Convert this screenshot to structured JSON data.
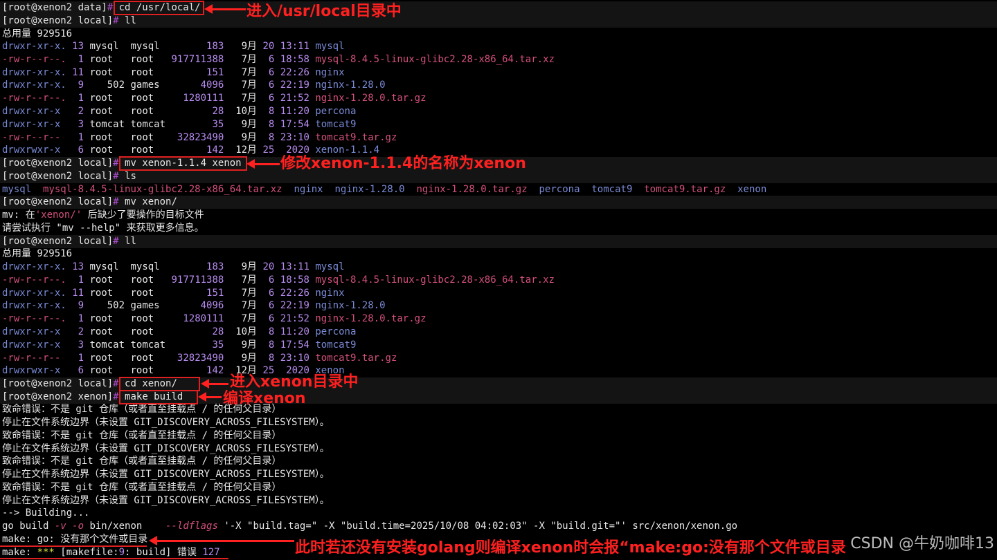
{
  "prompt_data": "[root@xenon2 data]",
  "prompt_local": "[root@xenon2 local]",
  "prompt_xenon": "[root@xenon2 xenon]",
  "hash": "#",
  "commands": {
    "cd_local": "cd /usr/local/",
    "ll": "ll",
    "mv": "mv xenon-1.1.4 xenon",
    "ls": "ls",
    "mv2": "mv xenon/",
    "cd_xenon": "cd xenon/",
    "make": "make build"
  },
  "total1": "总用量 929516",
  "listing1": [
    {
      "perm": "drwxr-xr-x.",
      "n": " 13",
      "u": "mysql ",
      "g": "mysql ",
      "size": "      183",
      "mon": "  9月",
      "day": " 20",
      "time": " 13:11",
      "name": "mysql",
      "kind": "dir"
    },
    {
      "perm": "-rw-r--r--.",
      "n": "  1",
      "u": "root  ",
      "g": "root  ",
      "size": "917711388",
      "mon": "  7月",
      "day": "  6",
      "time": " 18:58",
      "name": "mysql-8.4.5-linux-glibc2.28-x86_64.tar.xz",
      "kind": "arc"
    },
    {
      "perm": "drwxr-xr-x.",
      "n": " 11",
      "u": "root  ",
      "g": "root  ",
      "size": "      151",
      "mon": "  7月",
      "day": "  6",
      "time": " 22:26",
      "name": "nginx",
      "kind": "dir"
    },
    {
      "perm": "drwxr-xr-x.",
      "n": "  9",
      "u": "   502",
      "g": "games ",
      "size": "     4096",
      "mon": "  7月",
      "day": "  6",
      "time": " 22:19",
      "name": "nginx-1.28.0",
      "kind": "dir"
    },
    {
      "perm": "-rw-r--r--.",
      "n": "  1",
      "u": "root  ",
      "g": "root  ",
      "size": "  1280111",
      "mon": "  7月",
      "day": "  6",
      "time": " 21:52",
      "name": "nginx-1.28.0.tar.gz",
      "kind": "arc"
    },
    {
      "perm": "drwxr-xr-x ",
      "n": "  2",
      "u": "root  ",
      "g": "root  ",
      "size": "       28",
      "mon": " 10月",
      "day": "  8",
      "time": " 11:20",
      "name": "percona",
      "kind": "dir"
    },
    {
      "perm": "drwxr-xr-x ",
      "n": "  3",
      "u": "tomcat",
      "g": "tomcat",
      "size": "       35",
      "mon": "  9月",
      "day": "  8",
      "time": " 17:54",
      "name": "tomcat9",
      "kind": "dir"
    },
    {
      "perm": "-rw-r--r-- ",
      "n": "  1",
      "u": "root  ",
      "g": "root  ",
      "size": " 32823490",
      "mon": "  9月",
      "day": "  8",
      "time": " 23:10",
      "name": "tomcat9.tar.gz",
      "kind": "arc"
    },
    {
      "perm": "drwxrwxr-x ",
      "n": "  6",
      "u": "root  ",
      "g": "root  ",
      "size": "      142",
      "mon": " 12月",
      "day": " 25",
      "time": "  2020",
      "name": "xenon-1.1.4",
      "kind": "dir"
    }
  ],
  "ls_items": [
    {
      "name": "mysql",
      "kind": "dir"
    },
    {
      "name": "mysql-8.4.5-linux-glibc2.28-x86_64.tar.xz",
      "kind": "arc"
    },
    {
      "name": "nginx",
      "kind": "dir"
    },
    {
      "name": "nginx-1.28.0",
      "kind": "dir"
    },
    {
      "name": "nginx-1.28.0.tar.gz",
      "kind": "arc"
    },
    {
      "name": "percona",
      "kind": "dir"
    },
    {
      "name": "tomcat9",
      "kind": "dir"
    },
    {
      "name": "tomcat9.tar.gz",
      "kind": "arc"
    },
    {
      "name": "xenon",
      "kind": "dir"
    }
  ],
  "mv_err1_prefix": "mv: 在",
  "mv_err1_quote": "'xenon/'",
  "mv_err1_suffix": " 后缺少了要操作的目标文件",
  "mv_err2": "请尝试执行 \"mv --help\" 来获取更多信息。",
  "total2": "总用量 929516",
  "last_entry_name": "xenon",
  "git_err1": "致命错误：不是 git 仓库（或者直至挂载点 / 的任何父目录）",
  "git_err2": "停止在文件系统边界（未设置 GIT_DISCOVERY_ACROSS_FILESYSTEM）。",
  "building": "--> Building...",
  "gobuild": {
    "p1": "go build ",
    "flag1": "-v -o",
    "p2": " bin/xenon    ",
    "flag2": "--ldflags",
    "p3": " '-X \"build.tag=\" -X \"build.time=2025/10/08 04:02:03\" -X \"build.git=\"' src/xenon/xenon.go"
  },
  "make_err1": "make: go: 没有那个文件或目录",
  "make_err2": {
    "p1": "make: ",
    "stars": "***",
    "p2": " [makefile:",
    "n": "9",
    "p3": ": build] 错误 ",
    "code": "127"
  },
  "annotations": {
    "a1": "进入/usr/local目录中",
    "a2": "修改xenon-1.1.4的名称为xenon",
    "a3": "进入xenon目录中",
    "a4": "编译xenon",
    "a5": "此时若还没有安装golang则编译xenon时会报“make:go:没有那个文件或目录"
  },
  "watermark": "CSDN @牛奶咖啡13",
  "colors": {
    "annotation": "#ff2020",
    "dir": "#7a8bd6",
    "archive": "#d4507c",
    "hash": "#b04fd0"
  }
}
